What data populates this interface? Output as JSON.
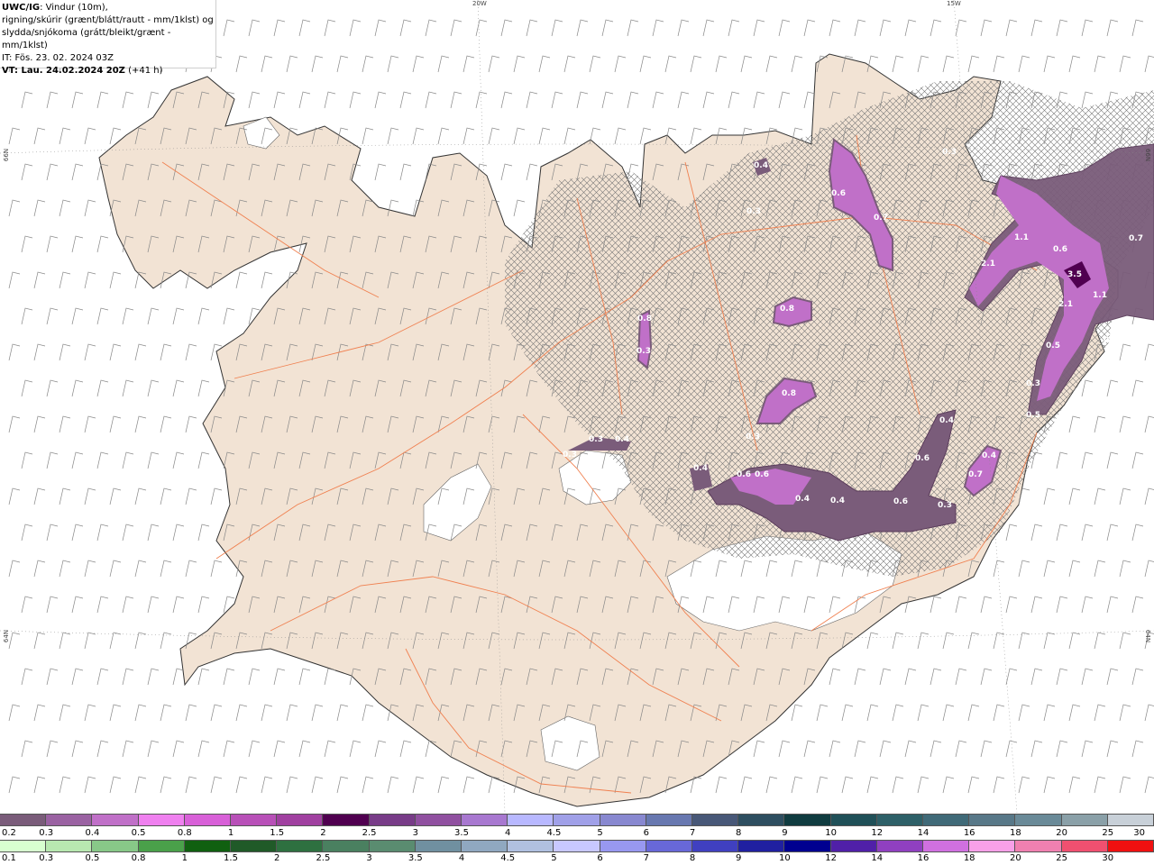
{
  "header": {
    "model": "UWC/IG",
    "line1_rest": ": Vindur (10m),",
    "line2": "rigning/skúrir (grænt/blátt/rautt - mm/1klst) og",
    "line3": "slydda/snjókoma (grátt/bleikt/grænt - mm/1klst)",
    "issue_time": "IT: Fös. 23. 02. 2024 03Z",
    "valid_prefix": "VT: Lau. 24.02.2024 20Z",
    "valid_offset": "(+41 h)"
  },
  "grid_labels": {
    "lon_20w": "20W",
    "lon_15w": "15W",
    "lat_66n_left": "66N",
    "lat_66n_right": "66N",
    "lat_64n_left": "64N",
    "lat_64n_right": "64N"
  },
  "map_values": [
    "0.4",
    "0.8",
    "0.6",
    "0.7",
    "0.3",
    "0.3",
    "1.1",
    "0.6",
    "2.1",
    "3.5",
    "1.1",
    "2.1",
    "0.5",
    "0.8",
    "0.7",
    "0.3",
    "0.8",
    "0.3",
    "0.3",
    "0.4",
    "0.3",
    "0.5",
    "0.6",
    "0.7",
    "0.4",
    "0.4",
    "0.6",
    "0.6",
    "0.4",
    "0.4",
    "0.3",
    "0.6",
    "0.4",
    "0.4",
    "0.3"
  ],
  "legend_snow": {
    "labels": [
      "0.2",
      "0.3",
      "0.4",
      "0.5",
      "0.8",
      "1",
      "1.5",
      "2",
      "2.5",
      "3",
      "3.5",
      "4",
      "4.5",
      "5",
      "6",
      "7",
      "8",
      "9",
      "10",
      "12",
      "14",
      "16",
      "18",
      "20",
      "25",
      "30"
    ],
    "colors": [
      "#7a5c7a",
      "#9a62a2",
      "#c070c8",
      "#ef80ef",
      "#d860d8",
      "#b850b8",
      "#a040a0",
      "#500050",
      "#783c88",
      "#9050a0",
      "#a878d0",
      "#b8b8ff",
      "#a0a0e8",
      "#8888d0",
      "#6878b0",
      "#485878",
      "#2e4e60",
      "#103c40",
      "#205058",
      "#2e6068",
      "#406a78",
      "#587888",
      "#6a8a98",
      "#8aa0a8",
      "#c8d0d8"
    ]
  },
  "legend_rain": {
    "labels": [
      "0.1",
      "0.3",
      "0.5",
      "0.8",
      "1",
      "1.5",
      "2",
      "2.5",
      "3",
      "3.5",
      "4",
      "4.5",
      "5",
      "6",
      "7",
      "8",
      "9",
      "10",
      "12",
      "14",
      "16",
      "18",
      "20",
      "25",
      "30"
    ],
    "colors": [
      "#d8ffd0",
      "#b8e8b0",
      "#88c888",
      "#4aa04a",
      "#106010",
      "#205a28",
      "#2e7040",
      "#4a8060",
      "#5a8c70",
      "#7090a0",
      "#90a8c0",
      "#b0c0e0",
      "#c8c8ff",
      "#9898f0",
      "#6868d8",
      "#4040c0",
      "#2020a0",
      "#000090",
      "#5020a8",
      "#9040c0",
      "#d070e0",
      "#f8a0e8",
      "#f080b0",
      "#f05070",
      "#f01010"
    ]
  },
  "colors": {
    "land": "#f2e3d4",
    "sea": "#ffffff",
    "roads": "#f08050",
    "coast": "#333333",
    "barbs": "#888888"
  }
}
